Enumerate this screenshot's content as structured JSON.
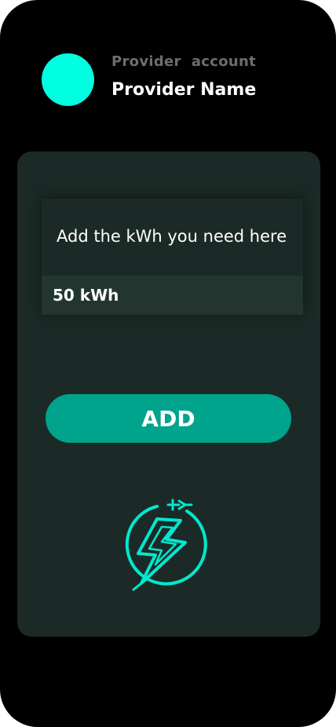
{
  "header": {
    "account_label": "Provider  account",
    "provider_name": "Provider Name"
  },
  "form": {
    "label": "Add the kWh you need here",
    "value": "50 kWh"
  },
  "actions": {
    "add_label": "ADD"
  },
  "colors": {
    "accent": "#00ffe0",
    "button": "#00a38c",
    "card": "#1b2a26"
  },
  "icons": {
    "avatar": "circle-avatar",
    "logo": "lightning-plug-icon"
  }
}
